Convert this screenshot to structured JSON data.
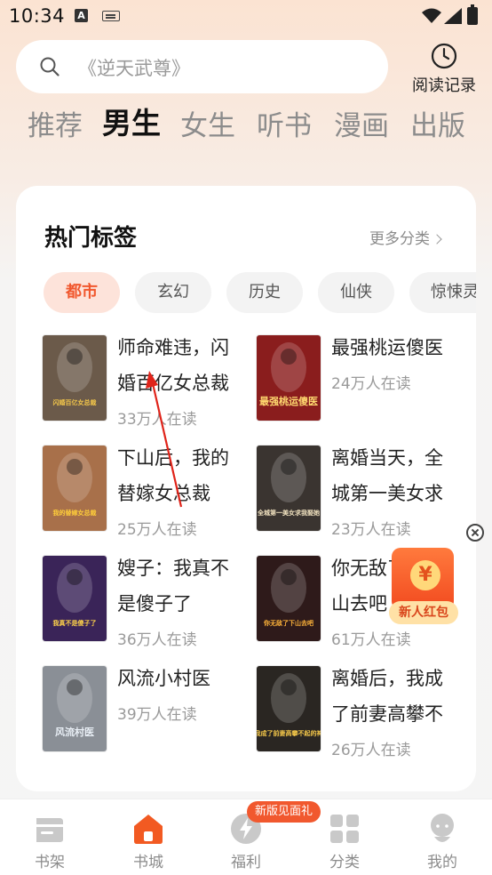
{
  "status_bar": {
    "time": "10:34",
    "notif_a": "A"
  },
  "search": {
    "placeholder": "《逆天武尊》"
  },
  "history": {
    "label": "阅读记录"
  },
  "category_tabs": [
    {
      "label": "推荐",
      "active": false
    },
    {
      "label": "男生",
      "active": true
    },
    {
      "label": "女生",
      "active": false
    },
    {
      "label": "听书",
      "active": false
    },
    {
      "label": "漫画",
      "active": false
    },
    {
      "label": "出版",
      "active": false
    }
  ],
  "hot_tags": {
    "title": "热门标签",
    "more_label": "更多分类",
    "tags": [
      {
        "label": "都市",
        "active": true
      },
      {
        "label": "玄幻",
        "active": false
      },
      {
        "label": "历史",
        "active": false
      },
      {
        "label": "仙侠",
        "active": false
      },
      {
        "label": "惊悚灵异",
        "active": false
      }
    ]
  },
  "books": [
    {
      "title": "师命难违，闪婚百亿女总裁",
      "readers": "33万人在读",
      "cover_text": "闪婚百亿女总裁",
      "cover_color": "#6b5a4a",
      "cover_accent": "#f5c84a"
    },
    {
      "title": "最强桃运傻医",
      "readers": "24万人在读",
      "cover_text": "最强桃运傻医",
      "cover_color": "#8a1d1d",
      "cover_accent": "#ffd970"
    },
    {
      "title": "下山后，我的替嫁女总裁",
      "readers": "25万人在读",
      "cover_text": "我的替嫁女总裁",
      "cover_color": "#a8704a",
      "cover_accent": "#ffce3a"
    },
    {
      "title": "离婚当天，全城第一美女求我娶她",
      "readers": "23万人在读",
      "cover_text": "全城第一美女求我娶她",
      "cover_color": "#3a3430",
      "cover_accent": "#f2e3c0"
    },
    {
      "title": "嫂子：我真不是傻子了",
      "readers": "36万人在读",
      "cover_text": "我真不是傻子了",
      "cover_color": "#3a2458",
      "cover_accent": "#ffd34a"
    },
    {
      "title": "你无敌了，下山去吧",
      "readers": "61万人在读",
      "cover_text": "你无敌了下山去吧",
      "cover_color": "#2e1a1a",
      "cover_accent": "#ffb43a"
    },
    {
      "title": "风流小村医",
      "readers": "39万人在读",
      "cover_text": "风流村医",
      "cover_color": "#8a8f96",
      "cover_accent": "#e8eef5"
    },
    {
      "title": "离婚后，我成了前妻高攀不起的神",
      "readers": "26万人在读",
      "cover_text": "我成了前妻高攀不起的神",
      "cover_color": "#2a2622",
      "cover_accent": "#f5c84a"
    }
  ],
  "float": {
    "label": "新人红包",
    "coin": "¥"
  },
  "bottom_nav": {
    "badge": "新版见面礼",
    "items": [
      {
        "label": "书架",
        "icon": "bookshelf-icon",
        "active": false
      },
      {
        "label": "书城",
        "icon": "bookstore-icon",
        "active": true
      },
      {
        "label": "福利",
        "icon": "welfare-icon",
        "active": false
      },
      {
        "label": "分类",
        "icon": "category-icon",
        "active": false
      },
      {
        "label": "我的",
        "icon": "profile-icon",
        "active": false
      }
    ]
  },
  "colors": {
    "accent": "#f25a22",
    "tag_active_bg": "#fde3da"
  }
}
